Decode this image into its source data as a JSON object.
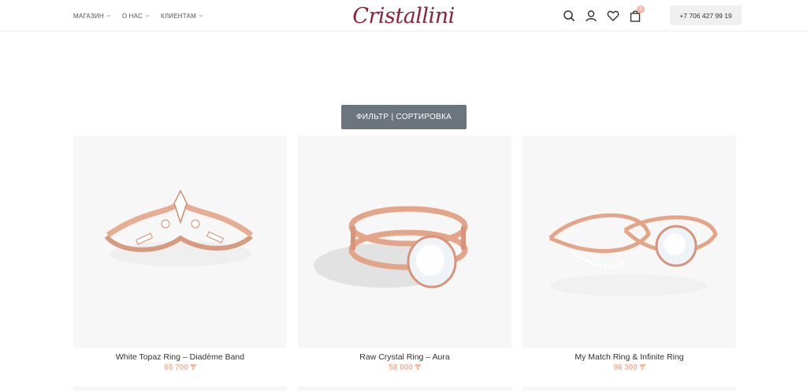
{
  "header": {
    "nav": [
      {
        "label": "МАГАЗИН"
      },
      {
        "label": "О НАС"
      },
      {
        "label": "КЛИЕНТАМ"
      }
    ],
    "logo": "Cristallini",
    "cart_count": "0",
    "phone": "+7 706 427 99 19",
    "icons": [
      "search-icon",
      "user-icon",
      "heart-icon",
      "bag-icon"
    ]
  },
  "filter": {
    "label": "ФИЛЬТР | СОРТИРОВКА"
  },
  "products": [
    {
      "name": "White Topaz Ring – Diadème Band",
      "price": "65 700 ₸"
    },
    {
      "name": "Raw Crystal Ring – Aura",
      "price": "58 000 ₸"
    },
    {
      "name": "My Match Ring & Infinite Ring",
      "price": "96 300 ₸"
    }
  ],
  "colors": {
    "brand": "#8d2236",
    "price": "#f0b49d",
    "filter_bg": "#6c757d",
    "badge": "#f2b8a8"
  }
}
